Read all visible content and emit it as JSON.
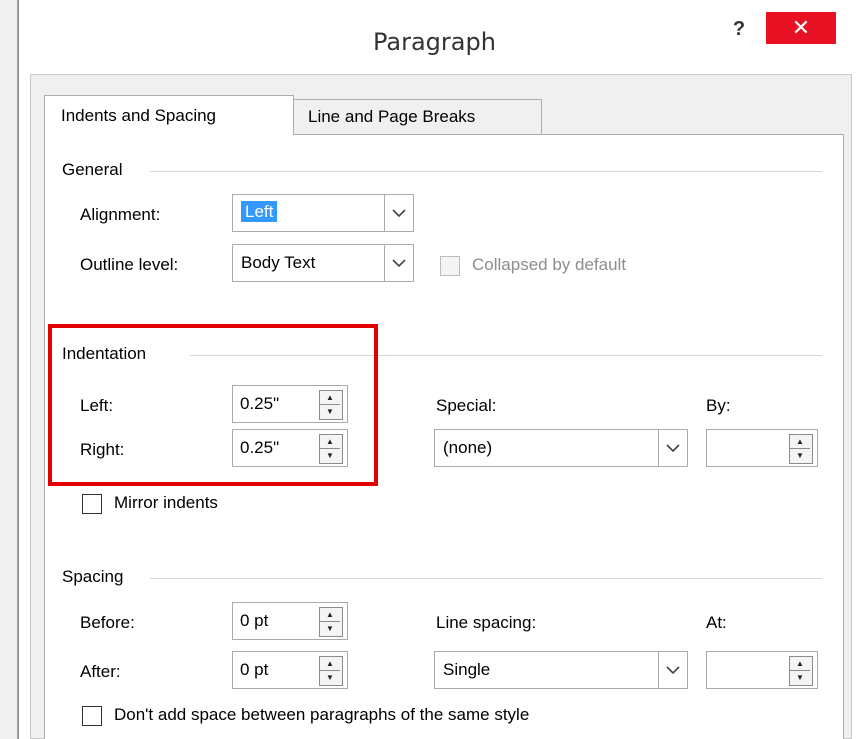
{
  "dialog": {
    "title": "Paragraph",
    "help_label": "?",
    "close_label": "✕"
  },
  "tabs": [
    {
      "label": "Indents and Spacing",
      "active": true
    },
    {
      "label": "Line and Page Breaks",
      "active": false
    }
  ],
  "general": {
    "title": "General",
    "alignment_label": "Alignment:",
    "alignment_value": "Left",
    "outline_label": "Outline level:",
    "outline_value": "Body Text",
    "collapsed_label": "Collapsed by default"
  },
  "indentation": {
    "title": "Indentation",
    "left_label": "Left:",
    "left_value": "0.25\"",
    "right_label": "Right:",
    "right_value": "0.25\"",
    "special_label": "Special:",
    "special_value": "(none)",
    "by_label": "By:",
    "by_value": "",
    "mirror_label": "Mirror indents"
  },
  "spacing": {
    "title": "Spacing",
    "before_label": "Before:",
    "before_value": "0 pt",
    "after_label": "After:",
    "after_value": "0 pt",
    "line_spacing_label": "Line spacing:",
    "line_spacing_value": "Single",
    "at_label": "At:",
    "at_value": "",
    "dont_add_label": "Don't add space between paragraphs of the same style"
  },
  "colors": {
    "close_red": "#e81123",
    "highlight_red": "#e00000",
    "selection_blue": "#3399ff"
  },
  "icons": {
    "dropdown": "chevron-down-icon",
    "spinner": "spinner-arrows-icon"
  }
}
